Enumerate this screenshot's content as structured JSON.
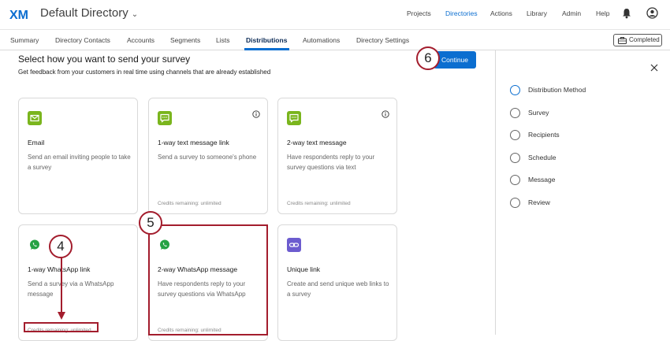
{
  "header": {
    "logo_text": "XM",
    "directory_title": "Default Directory",
    "nav": [
      "Projects",
      "Directories",
      "Actions",
      "Library",
      "Admin",
      "Help"
    ],
    "active_nav": "Directories"
  },
  "subnav": {
    "tabs": [
      "Summary",
      "Directory Contacts",
      "Accounts",
      "Segments",
      "Lists",
      "Distributions",
      "Automations",
      "Directory Settings"
    ],
    "active_tab": "Distributions",
    "status_label": "Completed"
  },
  "main": {
    "heading": "Select how you want to send your survey",
    "subheading": "Get feedback from your customers in real time using channels that are already established",
    "continue_label": "Continue",
    "cards": [
      {
        "title": "Email",
        "description": "Send an email inviting people to take a survey",
        "credits": "",
        "icon": "email-icon",
        "info": false
      },
      {
        "title": "1-way text message link",
        "description": "Send a survey to someone's phone",
        "credits": "Credits remaining: unlimited",
        "icon": "text-message-icon",
        "info": true
      },
      {
        "title": "2-way text message",
        "description": "Have respondents reply to your survey questions via text",
        "credits": "Credits remaining: unlimited",
        "icon": "text-message-icon",
        "info": true
      },
      {
        "title": "1-way WhatsApp link",
        "description": "Send a survey via a WhatsApp message",
        "credits": "Credits remaining: unlimited",
        "icon": "whatsapp-icon",
        "info": false
      },
      {
        "title": "2-way WhatsApp message",
        "description": "Have respondents reply to your survey questions via WhatsApp",
        "credits": "Credits remaining: unlimited",
        "icon": "whatsapp-icon",
        "info": false
      },
      {
        "title": "Unique link",
        "description": "Create and send unique web links to a survey",
        "credits": "",
        "icon": "link-icon",
        "info": false
      }
    ]
  },
  "sidebar": {
    "steps": [
      "Distribution Method",
      "Survey",
      "Recipients",
      "Schedule",
      "Message",
      "Review"
    ],
    "current_step": "Distribution Method"
  },
  "annotations": {
    "callouts": [
      "4",
      "5",
      "6"
    ]
  },
  "colors": {
    "accent": "#0b6ed0",
    "callout": "#a31d2d",
    "email_icon": "#7ab51d",
    "sms_icon": "#7ab51d",
    "whatsapp": "#25a244",
    "link_icon": "#6c5ccf"
  }
}
